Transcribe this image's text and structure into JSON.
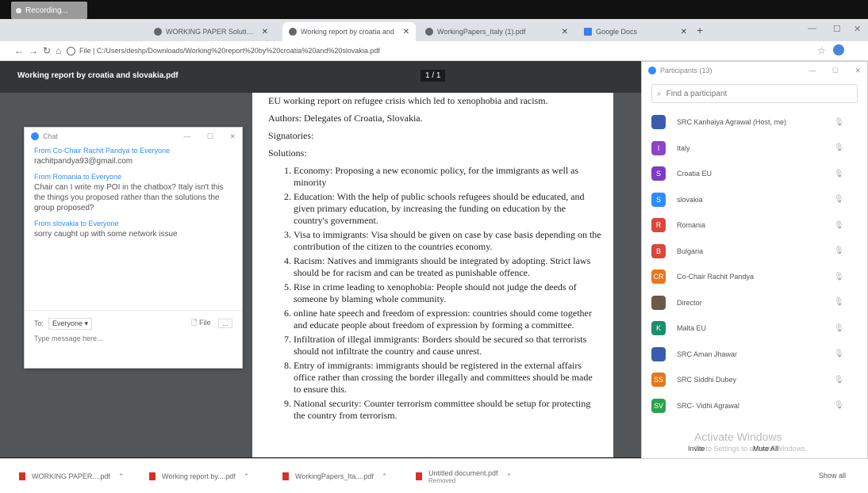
{
  "recording": {
    "label": "Recording..."
  },
  "browser": {
    "tabs": [
      {
        "label": "WORKING PAPER Solutions for"
      },
      {
        "label": "Working report by croatia and"
      },
      {
        "label": "WorkingPapers_Italy (1).pdf"
      },
      {
        "label": "Google Docs"
      }
    ],
    "new_tab": "+",
    "url": "File | C:/Users/deshp/Downloads/Working%20report%20by%20croatia%20and%20slovakia.pdf"
  },
  "pdf": {
    "title": "Working report by croatia and slovakia.pdf",
    "page_indicator": "1 / 1",
    "heading": "EU working report on refugee crisis which led to xenophobia and racism.",
    "authors": "Authors: Delegates of Croatia, Slovakia.",
    "signatories": "Signatories:",
    "solutions_label": "Solutions:",
    "solutions": [
      "Economy: Proposing a new economic policy, for the immigrants as well as minority",
      "Education: With the help of public schools refugees should be educated, and given primary education, by increasing the funding on education by the country's government.",
      "Visa to immigrants: Visa should be given on case by case basis depending on the contribution of the citizen to the countries economy.",
      "Racism: Natives and immigrants should be integrated by adopting. Strict laws should be for racism and can be treated as punishable offence.",
      "Rise in crime leading to xenophobia: People should not judge the deeds of someone by blaming whole community.",
      "online hate speech and freedom of expression: countries should come together and educate people about freedom of expression by forming a committee.",
      "Infiltration of illegal immigrants: Borders should be secured so that terrorists should not infiltrate the country and cause unrest.",
      "Entry of immigrants: immigrants should be registered in the external affairs office rather than crossing the border illegally and committees should be made to ensure this.",
      "National security: Counter terrorism committee should be setup for protecting the country from terrorism."
    ]
  },
  "chat": {
    "title": "Chat",
    "messages": [
      {
        "from": "From Co-Chair Rachit Pandya to Everyone",
        "text": "rachitpandya93@gmail.com"
      },
      {
        "from": "From Romania to Everyone",
        "text": "Chair can I write my POI in the chatbox? Italy isn't this the things you proposed rather than the solutions the group proposed?"
      },
      {
        "from": "From slovakia to Everyone",
        "text": "sorry caught up with some network issue"
      }
    ],
    "to_label": "To:",
    "to_value": "Everyone",
    "file_label": "File",
    "more_label": "...",
    "input_placeholder": "Type message here..."
  },
  "participants": {
    "title": "Participants (13)",
    "search_placeholder": "Find a participant",
    "list": [
      {
        "initials": "",
        "name": "SRC Kanhaiya Agrawal (Host, me)",
        "color": "#3b5bab"
      },
      {
        "initials": "I",
        "name": "Italy",
        "color": "#8e44c4"
      },
      {
        "initials": "S",
        "name": "Croatia EU",
        "color": "#7d3cc4"
      },
      {
        "initials": "S",
        "name": "slovakia",
        "color": "#2d8cff"
      },
      {
        "initials": "R",
        "name": "Romania",
        "color": "#d9473b"
      },
      {
        "initials": "B",
        "name": "Bulgaria",
        "color": "#d9473b"
      },
      {
        "initials": "CR",
        "name": "Co-Chair Rachit Pandya",
        "color": "#e8761c"
      },
      {
        "initials": "",
        "name": "Director",
        "color": "#6b5a4a"
      },
      {
        "initials": "K",
        "name": "Malta EU",
        "color": "#1a8f6a"
      },
      {
        "initials": "",
        "name": "SRC Aman Jhawar",
        "color": "#3b5bab"
      },
      {
        "initials": "SS",
        "name": "SRC Siddhi Dubey",
        "color": "#e8761c"
      },
      {
        "initials": "SV",
        "name": "SRC- Vidhi Agrawal",
        "color": "#2aa34a"
      }
    ],
    "invite_label": "Invite",
    "mute_all_label": "Mute All",
    "watermark_title": "Activate Windows",
    "watermark_sub": "Go to Settings to activate Windows."
  },
  "downloads": {
    "items": [
      {
        "name": "WORKING PAPER....pdf",
        "sub": ""
      },
      {
        "name": "Working report by....pdf",
        "sub": ""
      },
      {
        "name": "WorkingPapers_Ita....pdf",
        "sub": ""
      },
      {
        "name": "Untitled document.pdf",
        "sub": "Removed"
      }
    ],
    "show_all": "Show all"
  }
}
